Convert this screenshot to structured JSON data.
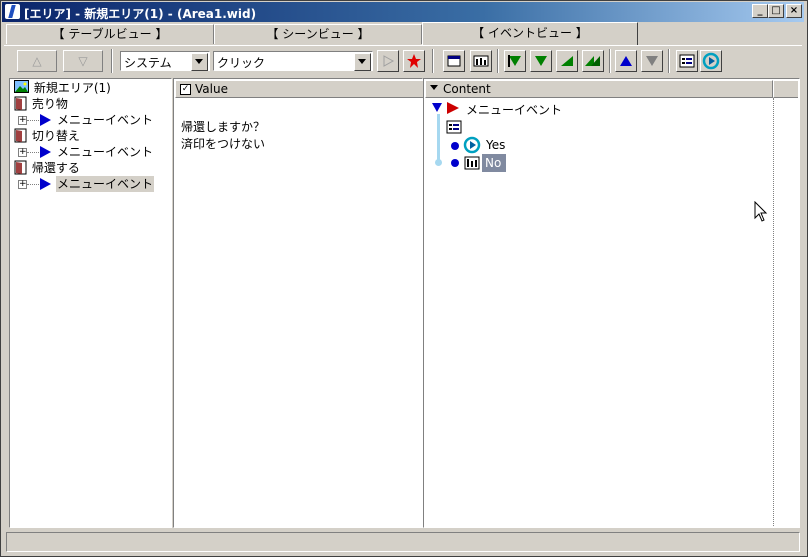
{
  "window": {
    "title": "[エリア] - 新規エリア(1) - (Area1.wid)"
  },
  "caption_buttons": {
    "minimize": "_",
    "maximize": "□",
    "close": "×"
  },
  "tabs": [
    {
      "label": "【 テーブルビュー 】"
    },
    {
      "label": "【 シーンビュー 】"
    },
    {
      "label": "【 イベントビュー 】",
      "active": true
    }
  ],
  "toolbar": {
    "up_label": "△",
    "down_label": "▽",
    "category_select": "システム",
    "action_select": "クリック"
  },
  "tree": {
    "root": "新規エリア(1)",
    "items": [
      {
        "label": "売り物",
        "child": "メニューイベント"
      },
      {
        "label": "切り替え",
        "child": "メニューイベント"
      },
      {
        "label": "帰還する",
        "child": "メニューイベント",
        "selected": true
      }
    ]
  },
  "value_panel": {
    "header": "Value",
    "lines": [
      "帰還しますか？",
      "済印をつけない"
    ]
  },
  "content_panel": {
    "header": "Content",
    "root_label": "メニューイベント",
    "options": [
      "Yes",
      "No"
    ]
  },
  "colors": {
    "title_start": "#0a246a",
    "title_end": "#a6caf0",
    "selection": "#c0c0c0",
    "accent_blue": "#0000cc",
    "accent_green": "#008000"
  }
}
